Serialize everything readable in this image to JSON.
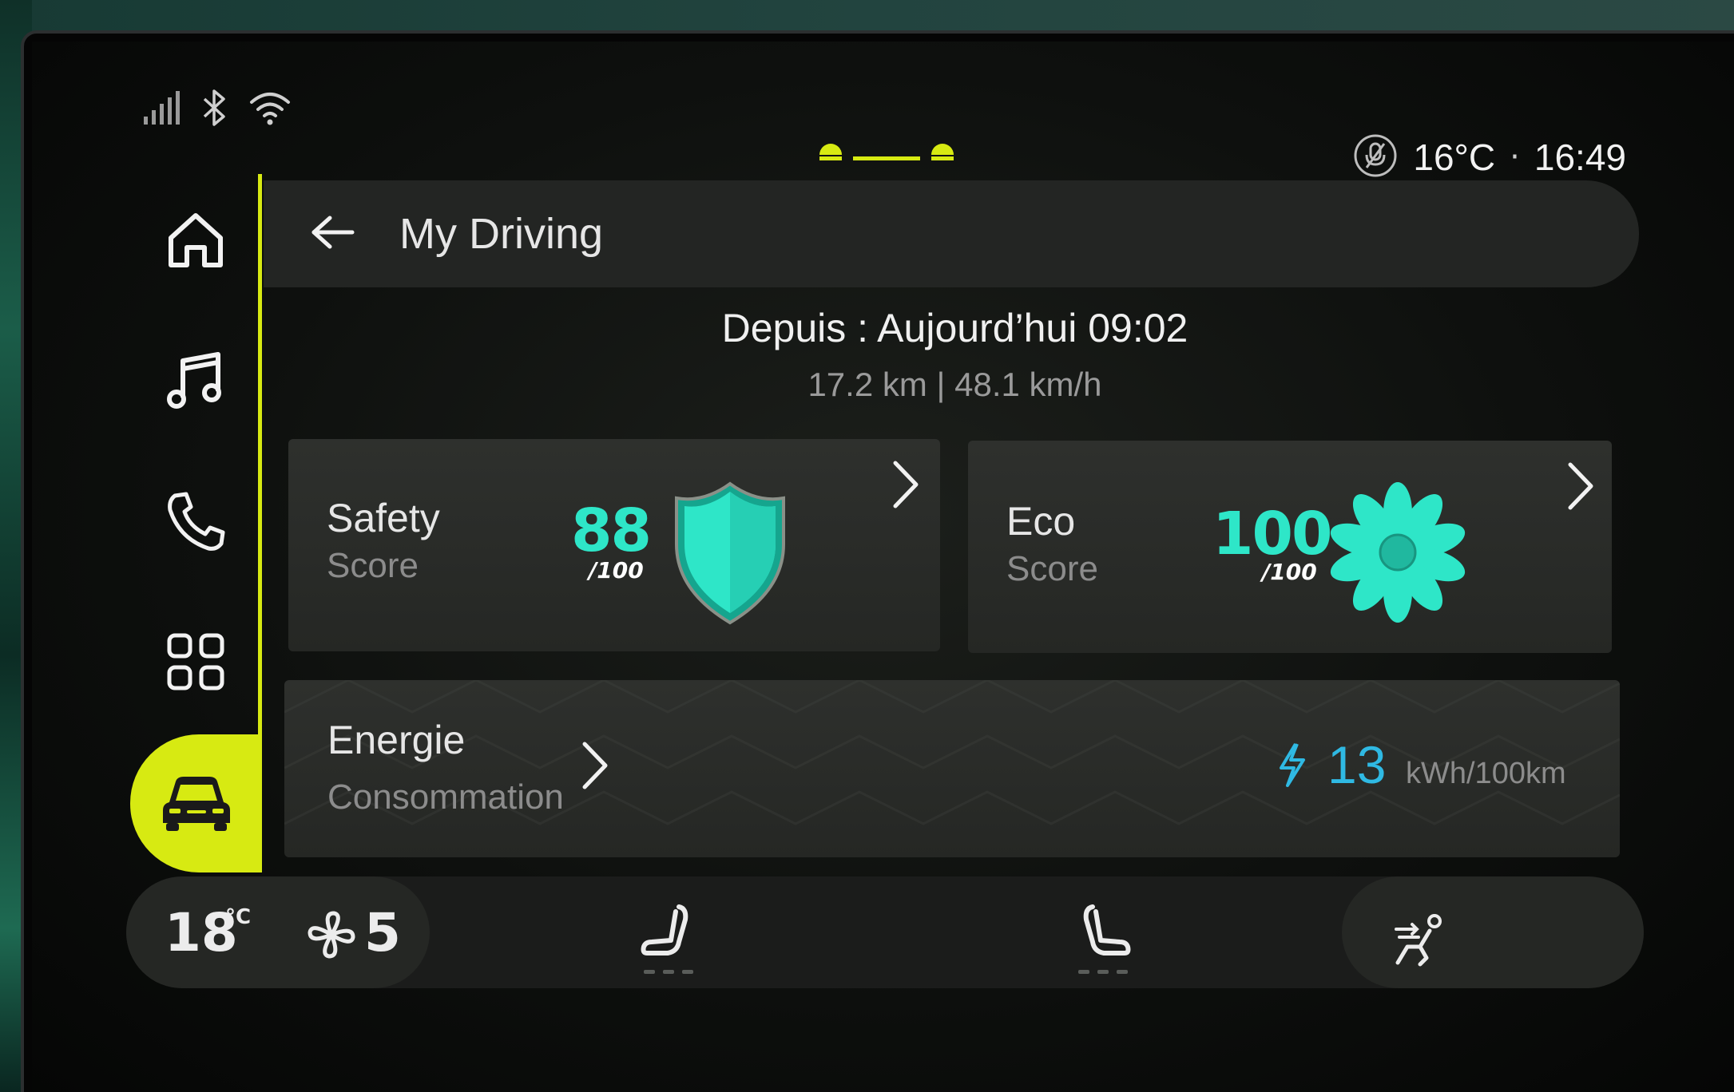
{
  "status_bar": {
    "outside_temp": "16°C",
    "separator": "·",
    "time": "16:49",
    "icons": [
      "signal-icon",
      "bluetooth-icon",
      "wifi-icon",
      "mic-off-icon"
    ]
  },
  "sidebar": {
    "items": [
      {
        "icon": "home-icon"
      },
      {
        "icon": "music-icon"
      },
      {
        "icon": "phone-icon"
      },
      {
        "icon": "apps-grid-icon"
      },
      {
        "icon": "car-icon",
        "active": true
      }
    ]
  },
  "header": {
    "title": "My Driving"
  },
  "trip": {
    "since": "Depuis : Aujourd’hui 09:02",
    "summary": "17.2 km | 48.1 km/h"
  },
  "safety_card": {
    "label": "Safety",
    "sub": "Score",
    "score": "88",
    "max": "/100"
  },
  "eco_card": {
    "label": "Eco",
    "sub": "Score",
    "score": "100",
    "max": "/100"
  },
  "energy_card": {
    "label": "Energie",
    "sub": "Consommation",
    "value": "13",
    "unit": "kWh/100km"
  },
  "climate": {
    "cabin_temp": "18",
    "cabin_unit": "°C",
    "fan_level": "5"
  },
  "colors": {
    "accent": "#d7ea12",
    "score": "#2ee6c8",
    "energy": "#2fb9e3"
  }
}
